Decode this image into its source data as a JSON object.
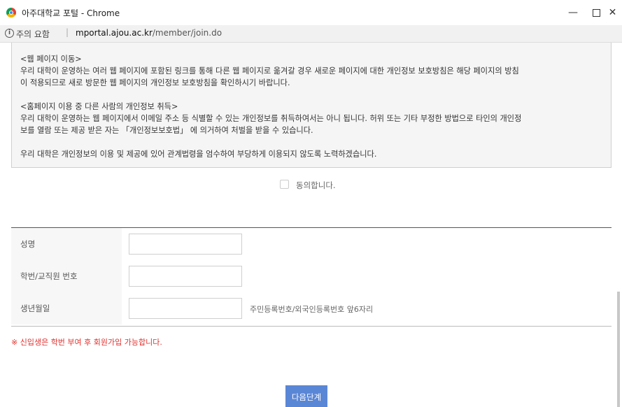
{
  "window": {
    "title": "아주대학교 포털 - Chrome",
    "minimize": "—",
    "close": "✕"
  },
  "address_bar": {
    "security_label": "주의 요함",
    "separator": "|",
    "url_host": "mportal.ajou.ac.kr",
    "url_path": "/member/join.do"
  },
  "policy": {
    "paragraphs": [
      "<웹 페이지 이동>\n우리 대학이 운영하는 여러 웹 페이지에 포함된 링크를 통해 다른 웹 페이지로 옮겨갈 경우 새로운 페이지에 대한 개인정보 보호방침은 해당 페이지의 방침\n이 적용되므로 새로 방문한 웹 페이지의 개인정보 보호방침을 확인하시기 바랍니다.",
      "<홈페이지 이용 중 다른 사람의 개인정보 취득>\n우리 대학이 운영하는 웹 페이지에서 이메일 주소 등 식별할 수 있는 개인정보를 취득하여서는 아니 됩니다. 허위 또는 기타 부정한 방법으로 타인의 개인정\n보를 열람 또는 제공 받은 자는 「개인정보보호법」 에 의거하여 처벌을 받을 수 있습니다.",
      "우리 대학은 개인정보의 이용 및 제공에 있어 관계법령을 엄수하여 부당하게 이용되지 않도록 노력하겠습니다."
    ]
  },
  "agree": {
    "label": "동의합니다.",
    "checked": false
  },
  "form": {
    "name_label": "성명",
    "name_value": "",
    "id_label": "학번/교직원 번호",
    "id_value": "",
    "birth_label": "생년월일",
    "birth_value": "",
    "birth_hint": "주민등록번호/외국인등록번호 앞6자리"
  },
  "notice": "※ 신입생은 학번 부여 후 회원가입 가능합니다.",
  "next_button": "다음단계",
  "colors": {
    "accent_button": "#5a86d6",
    "notice_text": "#e0302d"
  }
}
